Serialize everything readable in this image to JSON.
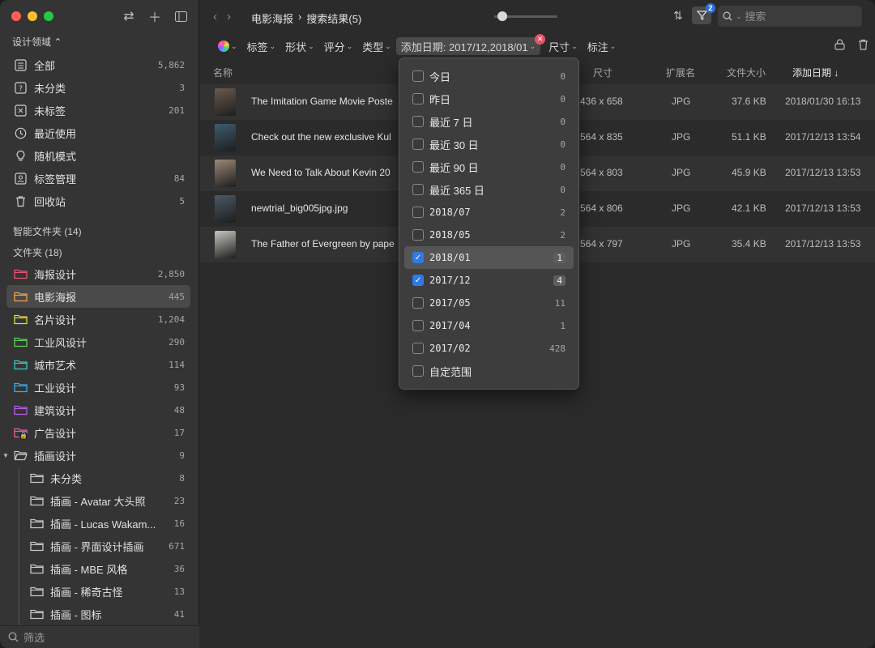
{
  "sidebar": {
    "scope_label": "设计领域",
    "library_items": [
      {
        "label": "全部",
        "count": "5,862",
        "icon": "library-icon"
      },
      {
        "label": "未分类",
        "count": "3",
        "icon": "uncategorized-icon"
      },
      {
        "label": "未标签",
        "count": "201",
        "icon": "untagged-icon"
      },
      {
        "label": "最近使用",
        "count": "",
        "icon": "clock-icon"
      },
      {
        "label": "随机模式",
        "count": "",
        "icon": "lightbulb-icon"
      },
      {
        "label": "标签管理",
        "count": "84",
        "icon": "tag-manager-icon"
      },
      {
        "label": "回收站",
        "count": "5",
        "icon": "trash-icon"
      }
    ],
    "smart_folders_label": "智能文件夹 (14)",
    "folders_label": "文件夹 (18)",
    "folders": [
      {
        "label": "海报设计",
        "count": "2,850",
        "color": "#e9536b"
      },
      {
        "label": "电影海报",
        "count": "445",
        "color": "#f0a24a"
      },
      {
        "label": "名片设计",
        "count": "1,204",
        "color": "#e8d441"
      },
      {
        "label": "工业风设计",
        "count": "290",
        "color": "#5ccf5a"
      },
      {
        "label": "城市艺术",
        "count": "114",
        "color": "#3ec7c0"
      },
      {
        "label": "工业设计",
        "count": "93",
        "color": "#3aa8f2"
      },
      {
        "label": "建筑设计",
        "count": "48",
        "color": "#b160e8"
      },
      {
        "label": "广告设计",
        "count": "17",
        "color": "#ea5ea6"
      },
      {
        "label": "插画设计",
        "count": "9",
        "color": "#c8c8c8"
      }
    ],
    "subfolders": [
      {
        "label": "未分类",
        "count": "8"
      },
      {
        "label": "插画 - Avatar 大头照",
        "count": "23"
      },
      {
        "label": "插画 - Lucas Wakam...",
        "count": "16"
      },
      {
        "label": "插画 - 界面设计插画",
        "count": "671"
      },
      {
        "label": "插画 - MBE 风格",
        "count": "36"
      },
      {
        "label": "插画 - 稀奇古怪",
        "count": "13"
      },
      {
        "label": "插画 - 图标",
        "count": "41"
      }
    ],
    "filter_placeholder": "筛选"
  },
  "toolbar": {
    "breadcrumb_folder": "电影海报",
    "breadcrumb_sep": "›",
    "breadcrumb_result": "搜索结果(5)",
    "filter_badge": "2",
    "search_placeholder": "搜索"
  },
  "filters": {
    "tags": "标签",
    "shape": "形状",
    "rating": "评分",
    "type": "类型",
    "date_added": "添加日期: 2017/12,2018/01",
    "size": "尺寸",
    "annotation": "标注"
  },
  "table": {
    "headers": {
      "name": "名称",
      "size": "尺寸",
      "ext": "扩展名",
      "filesize": "文件大小",
      "date": "添加日期 ↓"
    },
    "rows": [
      {
        "name": "The Imitation Game Movie Poste",
        "size": "436 x 658",
        "ext": "JPG",
        "filesize": "37.6 KB",
        "date": "2018/01/30 16:13",
        "thumb": "#6a5a4e"
      },
      {
        "name": "Check out the new exclusive Kul",
        "size": "564 x 835",
        "ext": "JPG",
        "filesize": "51.1 KB",
        "date": "2017/12/13 13:54",
        "thumb": "#3e5c6e"
      },
      {
        "name": "We Need to Talk About Kevin 20",
        "size": "564 x 803",
        "ext": "JPG",
        "filesize": "45.9 KB",
        "date": "2017/12/13 13:53",
        "thumb": "#9b8877"
      },
      {
        "name": "newtrial_big005jpg.jpg",
        "size": "564 x 806",
        "ext": "JPG",
        "filesize": "42.1 KB",
        "date": "2017/12/13 13:53",
        "thumb": "#4b5966"
      },
      {
        "name": "The Father of Evergreen by pape",
        "size": "564 x 797",
        "ext": "JPG",
        "filesize": "35.4 KB",
        "date": "2017/12/13 13:53",
        "thumb": "#c9c6bf"
      }
    ]
  },
  "date_dropdown": [
    {
      "label": "今日",
      "count": "0",
      "checked": false
    },
    {
      "label": "昨日",
      "count": "0",
      "checked": false
    },
    {
      "label": "最近 7 日",
      "count": "0",
      "checked": false
    },
    {
      "label": "最近 30 日",
      "count": "0",
      "checked": false
    },
    {
      "label": "最近 90 日",
      "count": "0",
      "checked": false
    },
    {
      "label": "最近 365 日",
      "count": "0",
      "checked": false
    },
    {
      "label": "2018/07",
      "count": "2",
      "checked": false
    },
    {
      "label": "2018/05",
      "count": "2",
      "checked": false
    },
    {
      "label": "2018/01",
      "count": "1",
      "checked": true
    },
    {
      "label": "2017/12",
      "count": "4",
      "checked": true
    },
    {
      "label": "2017/05",
      "count": "11",
      "checked": false
    },
    {
      "label": "2017/04",
      "count": "1",
      "checked": false
    },
    {
      "label": "2017/02",
      "count": "428",
      "checked": false
    },
    {
      "label": "自定范围",
      "count": "",
      "checked": false
    }
  ]
}
